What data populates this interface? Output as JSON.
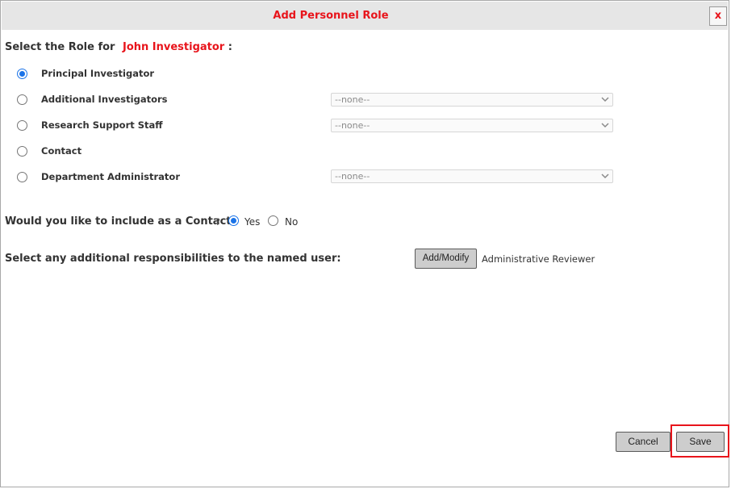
{
  "dialog": {
    "title": "Add Personnel Role",
    "close_label": "x"
  },
  "role_section": {
    "prompt": "Select the Role for",
    "person_name": "John Investigator",
    "colon": ":",
    "roles": [
      {
        "label": "Principal Investigator",
        "selected": true,
        "dropdown": null
      },
      {
        "label": "Additional Investigators",
        "selected": false,
        "dropdown": "--none--"
      },
      {
        "label": "Research Support Staff",
        "selected": false,
        "dropdown": "--none--"
      },
      {
        "label": "Contact",
        "selected": false,
        "dropdown": null
      },
      {
        "label": "Department Administrator",
        "selected": false,
        "dropdown": "--none--"
      }
    ]
  },
  "contact_section": {
    "question": "Would you like to include as a Contact",
    "qmark": "?",
    "yes_label": "Yes",
    "no_label": "No",
    "selected": "Yes"
  },
  "responsibilities": {
    "label": "Select any additional responsibilities to the named user:",
    "button_label": "Add/Modify",
    "current_value": "Administrative Reviewer"
  },
  "footer": {
    "cancel_label": "Cancel",
    "save_label": "Save",
    "highlight_color": "#e8141b"
  },
  "colors": {
    "accent_red": "#e8141b",
    "radio_blue": "#1a73e8",
    "titlebar_bg": "#e6e6e6"
  }
}
